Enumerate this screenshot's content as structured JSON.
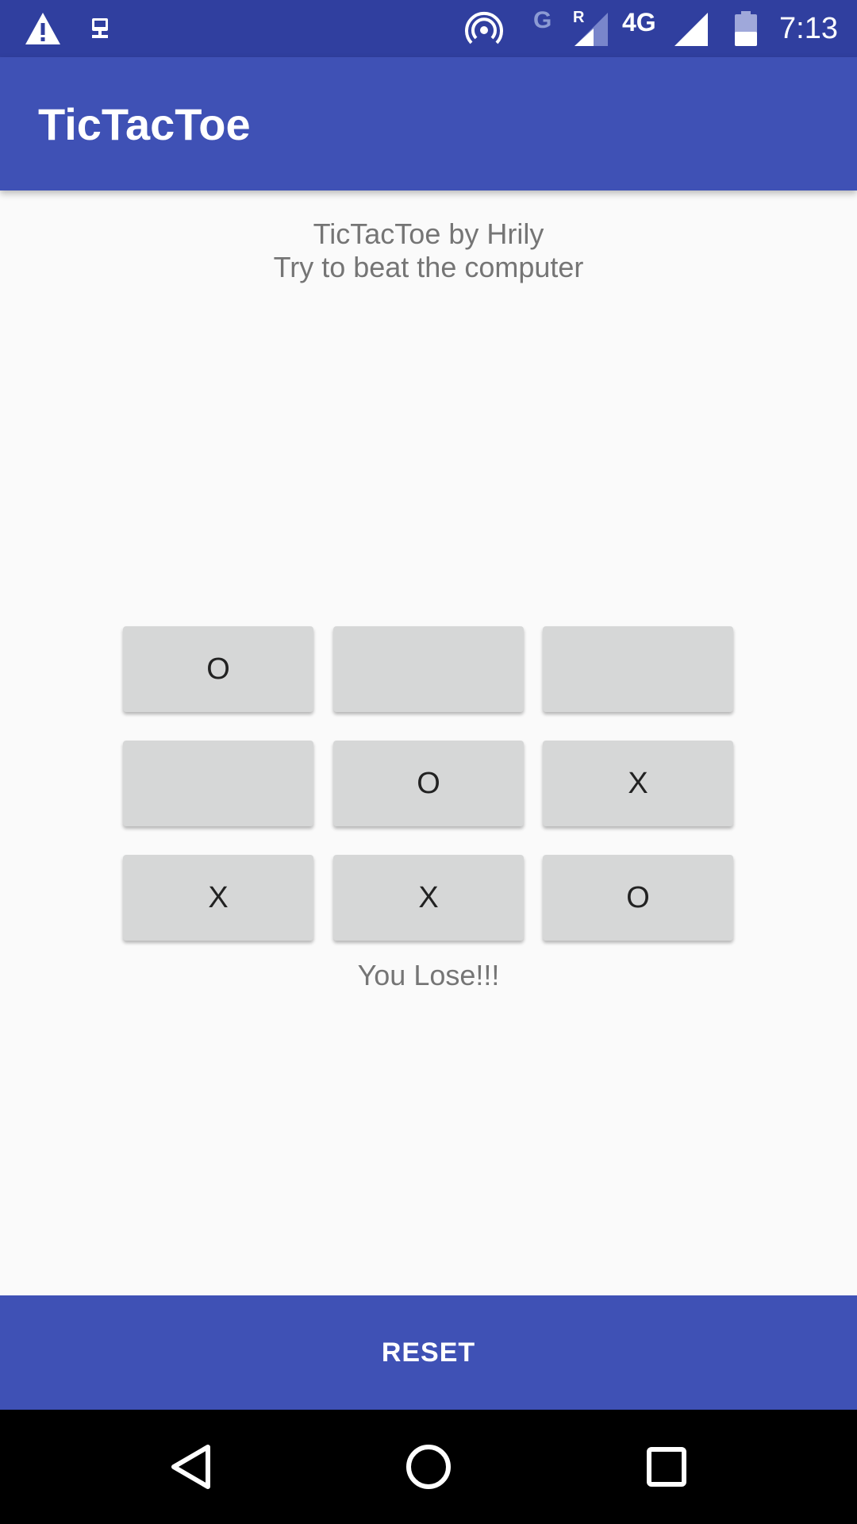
{
  "status_bar": {
    "time": "7:13",
    "network_label": "4G",
    "g_label": "G",
    "r_label": "R",
    "icons": [
      "warning-icon",
      "network-tray-icon",
      "hotspot-icon",
      "signal-icon",
      "signal-icon",
      "battery-icon"
    ]
  },
  "app_bar": {
    "title": "TicTacToe"
  },
  "intro": {
    "line1": "TicTacToe by Hrily",
    "line2": "Try to beat the computer"
  },
  "board": {
    "cells": [
      "O",
      "",
      "",
      "",
      "O",
      "X",
      "X",
      "X",
      "O"
    ]
  },
  "result": {
    "message": "You Lose!!!"
  },
  "reset": {
    "label": "RESET"
  },
  "nav_bar": {
    "icons": [
      "back-icon",
      "home-icon",
      "recents-icon"
    ]
  },
  "colors": {
    "primary": "#3f51b5",
    "primary_dark": "#303f9f",
    "background": "#fafafa",
    "cell": "#d6d7d7"
  }
}
